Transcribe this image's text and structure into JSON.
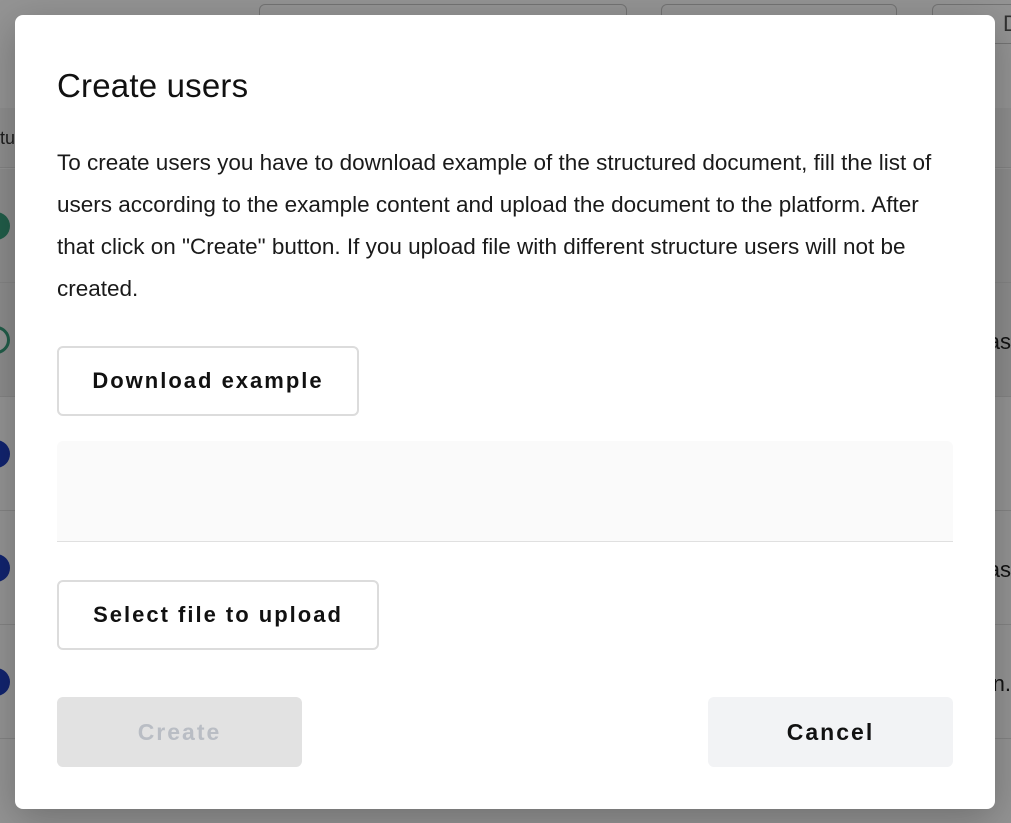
{
  "background": {
    "header_fragment": "tu",
    "row_fragments": [
      "as",
      "as",
      "n."
    ],
    "avatar_colors": [
      "#3aa17e",
      "#3aa17e",
      "#1f3fbf",
      "#1f3fbf",
      "#1f3fbf"
    ],
    "top_fragment": "D"
  },
  "dialog": {
    "title": "Create users",
    "description": "To create users you have to download example of the structured document, fill the list of users according to the example content and upload the document to the platform. After that click on \"Create\" button. If you upload file with different structure users will not be created.",
    "download_label": "Download example",
    "select_file_label": "Select file to upload",
    "create_label": "Create",
    "cancel_label": "Cancel"
  }
}
